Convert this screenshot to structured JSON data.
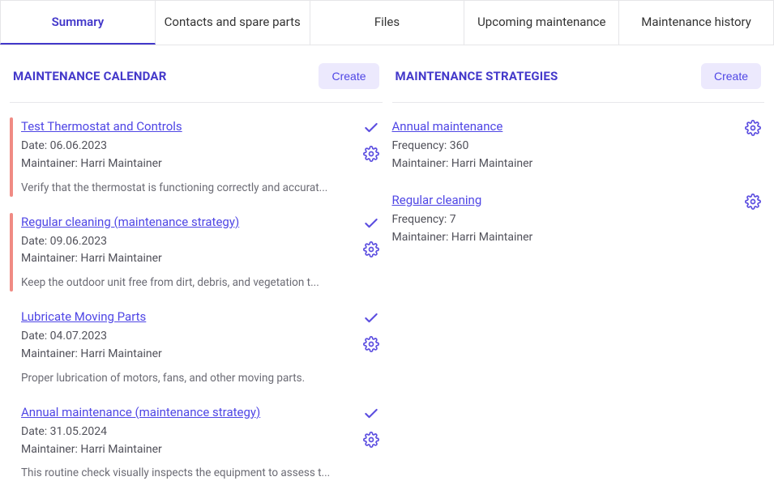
{
  "tabs": [
    {
      "label": "Summary",
      "active": true
    },
    {
      "label": "Contacts and spare parts",
      "active": false
    },
    {
      "label": "Files",
      "active": false
    },
    {
      "label": "Upcoming maintenance",
      "active": false
    },
    {
      "label": "Maintenance history",
      "active": false
    }
  ],
  "calendar": {
    "title": "MAINTENANCE CALENDAR",
    "create_label": "Create",
    "items": [
      {
        "title": "Test Thermostat and Controls",
        "date_label": "Date: 06.06.2023",
        "maintainer_label": "Maintainer: Harri Maintainer",
        "desc": "Verify that the thermostat is functioning correctly and accurat...",
        "bar": "red"
      },
      {
        "title": "Regular cleaning (maintenance strategy)",
        "date_label": "Date: 09.06.2023",
        "maintainer_label": "Maintainer: Harri Maintainer",
        "desc": "Keep the outdoor unit free from dirt, debris, and vegetation t...",
        "bar": "red"
      },
      {
        "title": "Lubricate Moving Parts",
        "date_label": "Date: 04.07.2023",
        "maintainer_label": "Maintainer: Harri Maintainer",
        "desc": "Proper lubrication of motors, fans, and other moving parts.",
        "bar": "none"
      },
      {
        "title": "Annual maintenance (maintenance strategy)",
        "date_label": "Date: 31.05.2024",
        "maintainer_label": "Maintainer: Harri Maintainer",
        "desc": "This routine check visually inspects the equipment to assess t...",
        "bar": "none"
      }
    ]
  },
  "strategies": {
    "title": "MAINTENANCE STRATEGIES",
    "create_label": "Create",
    "items": [
      {
        "title": "Annual maintenance",
        "frequency_label": "Frequency: 360",
        "maintainer_label": "Maintainer: Harri Maintainer"
      },
      {
        "title": "Regular cleaning",
        "frequency_label": "Frequency: 7",
        "maintainer_label": "Maintainer: Harri Maintainer"
      }
    ]
  }
}
